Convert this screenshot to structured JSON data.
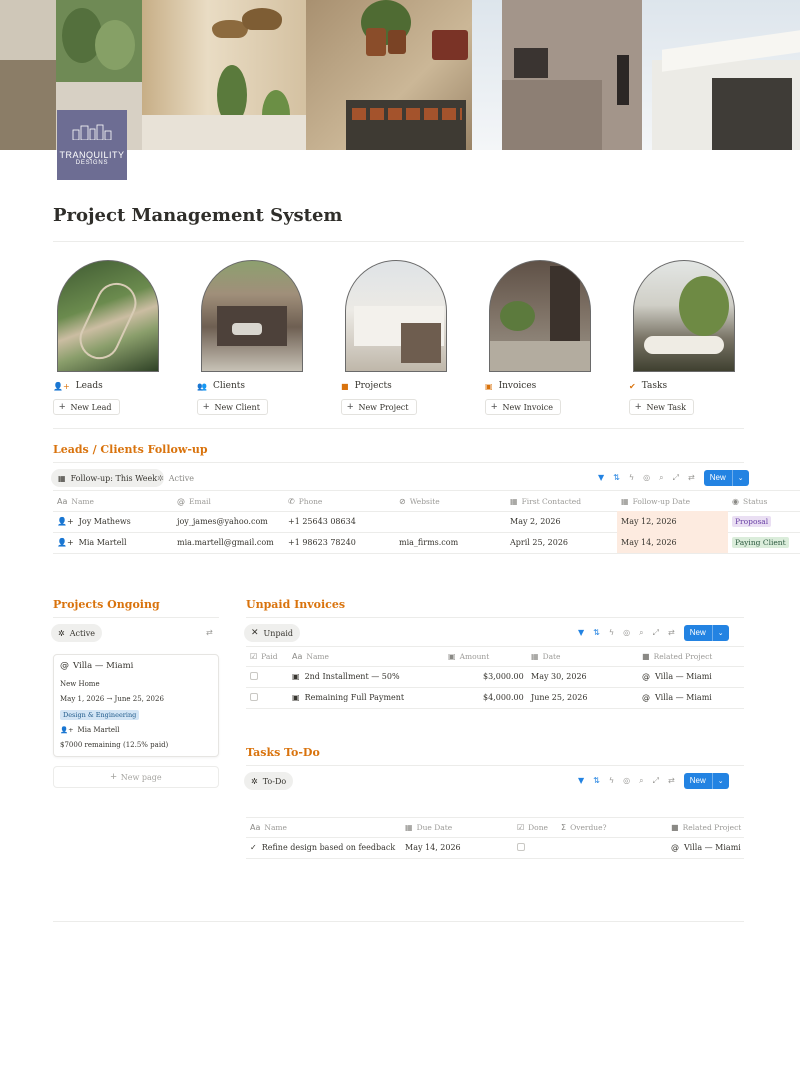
{
  "cover": {
    "logo_line1": "TRANQUILITY",
    "logo_line2": "DESIGNS"
  },
  "page": {
    "title": "Project Management System"
  },
  "gallery": [
    {
      "label": "Leads",
      "icon": "add-person-icon",
      "button": "New Lead"
    },
    {
      "label": "Clients",
      "icon": "people-icon",
      "button": "New Client"
    },
    {
      "label": "Projects",
      "icon": "folder-icon",
      "button": "New Project"
    },
    {
      "label": "Invoices",
      "icon": "money-icon",
      "button": "New Invoice"
    },
    {
      "label": "Tasks",
      "icon": "check-circle-icon",
      "button": "New Task"
    }
  ],
  "followup": {
    "title": "Leads / Clients Follow-up",
    "view_active": "Follow-up: This Week",
    "view_other": "Active",
    "new_label": "New",
    "columns": [
      "Name",
      "Email",
      "Phone",
      "Website",
      "First Contacted",
      "Follow-up Date",
      "Status"
    ],
    "rows": [
      {
        "name": "Joy Mathews",
        "email": "joy_james@yahoo.com",
        "phone": "+1 25643 08634",
        "website": "",
        "first": "May 2, 2026",
        "followup": "May 12, 2026",
        "status": "Proposal"
      },
      {
        "name": "Mia Martell",
        "email": "mia.martell@gmail.com",
        "phone": "+1 98623 78240",
        "website": "mia_firms.com",
        "first": "April 25, 2026",
        "followup": "May 14, 2026",
        "status": "Paying Client"
      }
    ]
  },
  "projects": {
    "title": "Projects Ongoing",
    "view": "Active",
    "card": {
      "name": "Villa — Miami",
      "type": "New Home",
      "dates": "May 1, 2026 → June 25, 2026",
      "tag": "Design & Engineering",
      "owner": "Mia Martell",
      "remaining": "$7000 remaining (12.5% paid)"
    },
    "new_page": "New page"
  },
  "invoices": {
    "title": "Unpaid Invoices",
    "view": "Unpaid",
    "new_label": "New",
    "columns": [
      "Paid",
      "Name",
      "Amount",
      "Date",
      "Related Project"
    ],
    "rows": [
      {
        "name": "2nd Installment — 50%",
        "amount": "$3,000.00",
        "date": "May 30, 2026",
        "project": "Villa — Miami"
      },
      {
        "name": "Remaining Full Payment",
        "amount": "$4,000.00",
        "date": "June 25, 2026",
        "project": "Villa — Miami"
      }
    ]
  },
  "tasks": {
    "title": "Tasks To-Do",
    "view": "To-Do",
    "new_label": "New",
    "columns": [
      "Name",
      "Due Date",
      "Done",
      "Overdue?",
      "Related Project"
    ],
    "rows": [
      {
        "name": "Refine design based on feedback",
        "due": "May 14, 2026",
        "project": "Villa — Miami"
      }
    ]
  },
  "colors": {
    "accent_orange": "#d9730d",
    "button_blue": "#2383e2",
    "followup_highlight": "#fdebe0",
    "tag_proposal": "#eadff3",
    "tag_paying": "#dbeddb",
    "tag_design": "#d3e5f5"
  }
}
